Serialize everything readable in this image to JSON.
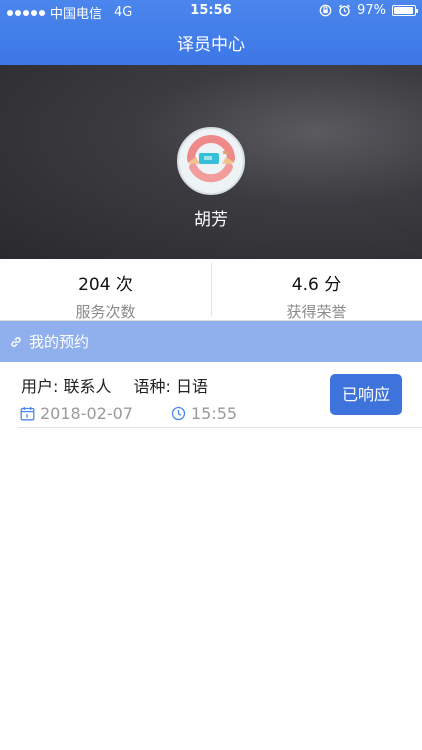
{
  "status_bar": {
    "carrier": "中国电信",
    "network": "4G",
    "time": "15:56",
    "battery": "97%"
  },
  "nav": {
    "title": "译员中心"
  },
  "profile": {
    "name": "胡芳"
  },
  "stats": [
    {
      "value": "204 次",
      "label": "服务次数"
    },
    {
      "value": "4.6 分",
      "label": "获得荣誉"
    }
  ],
  "section": {
    "title": "我的预约"
  },
  "appointment": {
    "user": "用户: 联系人",
    "language": "语种: 日语",
    "date": "2018-02-07",
    "time": "15:55",
    "status_button": "已响应"
  },
  "colors": {
    "header": "#3c77e6",
    "section_bar": "#8fb0ec",
    "button": "#3f73dc",
    "icon_blue": "#4a86ec"
  }
}
